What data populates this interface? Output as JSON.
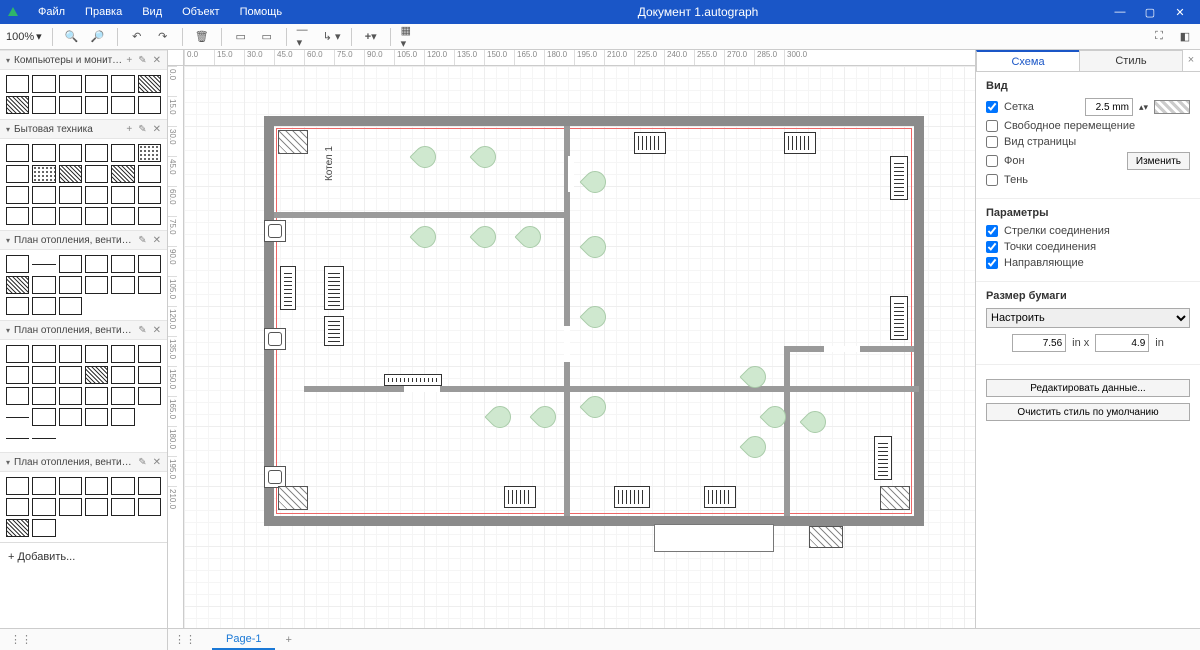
{
  "app": {
    "title": "Документ 1.autograph"
  },
  "menu": {
    "file": "Файл",
    "edit": "Правка",
    "view": "Вид",
    "object": "Объект",
    "help": "Помощь"
  },
  "toolbar": {
    "zoom": "100%"
  },
  "shapes": {
    "group1": "Компьютеры и мониторы",
    "group2": "Бытовая техника",
    "group3": "План отопления, вентиляции...",
    "group4": "План отопления, вентиляции...",
    "group5": "План отопления, вентиляции...",
    "add": "+  Добавить..."
  },
  "plan": {
    "room_label": "Котел 1"
  },
  "right": {
    "tab_scheme": "Схема",
    "tab_style": "Стиль",
    "sec_view": "Вид",
    "chk_grid": "Сетка",
    "grid_val": "2.5 mm",
    "chk_free": "Свободное перемещение",
    "chk_page": "Вид страницы",
    "chk_bg": "Фон",
    "btn_change": "Изменить",
    "chk_shadow": "Тень",
    "sec_params": "Параметры",
    "chk_conn_arrows": "Стрелки соединения",
    "chk_conn_points": "Точки соединения",
    "chk_guides": "Направляющие",
    "sec_paper": "Размер бумаги",
    "paper_preset": "Настроить",
    "paper_w": "7.56",
    "unit1": "in x",
    "paper_h": "4.9",
    "unit2": "in",
    "btn_edit_data": "Редактировать данные...",
    "btn_clear_style": "Очистить стиль по умолчанию"
  },
  "footer": {
    "page": "Page-1"
  },
  "ruler_h": [
    "0.0",
    "15.0",
    "30.0",
    "45.0",
    "60.0",
    "75.0",
    "90.0",
    "105.0",
    "120.0",
    "135.0",
    "150.0",
    "165.0",
    "180.0",
    "195.0",
    "210.0",
    "225.0",
    "240.0",
    "255.0",
    "270.0",
    "285.0",
    "300.0"
  ],
  "ruler_v": [
    "0.0",
    "15.0",
    "30.0",
    "45.0",
    "60.0",
    "75.0",
    "90.0",
    "105.0",
    "120.0",
    "135.0",
    "150.0",
    "165.0",
    "180.0",
    "195.0",
    "210.0"
  ]
}
